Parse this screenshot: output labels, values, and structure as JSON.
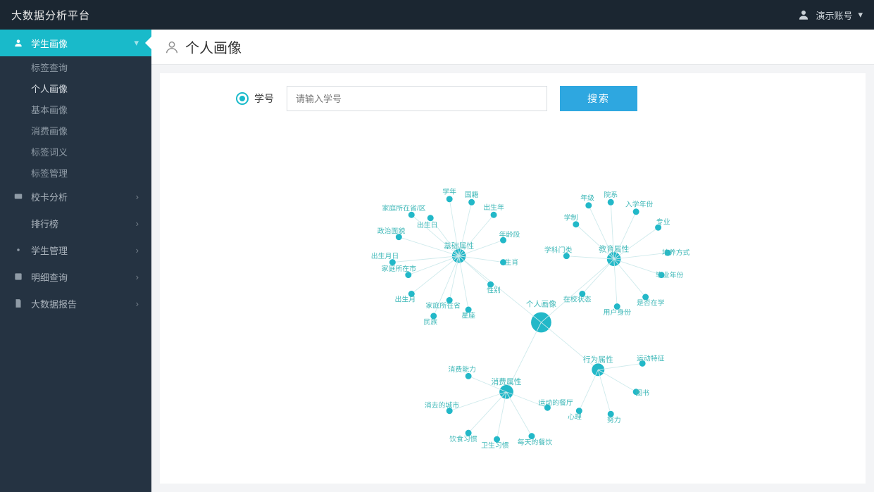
{
  "app": {
    "title": "大数据分析平台"
  },
  "user": {
    "name": "演示账号"
  },
  "sidebar": {
    "items": [
      {
        "label": "学生画像",
        "icon": "user-icon",
        "active": true
      },
      {
        "label": "校卡分析",
        "icon": "card-icon"
      },
      {
        "label": "排行榜",
        "icon": "rank-icon"
      },
      {
        "label": "学生管理",
        "icon": "manage-icon"
      },
      {
        "label": "明细查询",
        "icon": "detail-icon"
      },
      {
        "label": "大数据报告",
        "icon": "report-icon"
      }
    ],
    "sub": [
      {
        "label": "标签查询"
      },
      {
        "label": "个人画像",
        "current": true
      },
      {
        "label": "基本画像"
      },
      {
        "label": "消费画像"
      },
      {
        "label": "标签词义"
      },
      {
        "label": "标签管理"
      }
    ]
  },
  "page": {
    "title": "个人画像"
  },
  "form": {
    "radio_label": "学号",
    "input_placeholder": "请输入学号",
    "button": "搜索"
  },
  "graph": {
    "root": "个人画像",
    "clusters": [
      {
        "center": "基础属性",
        "nodes": [
          "学年",
          "国籍",
          "出生年",
          "年龄段",
          "生肖",
          "性别",
          "星座",
          "民族",
          "出生月",
          "出生月日",
          "家庭所在市",
          "家庭所在省",
          "政治面貌",
          "家庭所在省/区",
          "出生日"
        ]
      },
      {
        "center": "教育属性",
        "nodes": [
          "年级",
          "院系",
          "入学年份",
          "专业",
          "培养方式",
          "学制",
          "毕业年份",
          "是否在学",
          "用户身份",
          "在校状态",
          "学科门类"
        ]
      },
      {
        "center": "消费属性",
        "nodes": [
          "消费能力",
          "消去的城市",
          "饮食习惯",
          "卫生习惯",
          "每天的餐饮",
          "运动的餐厅"
        ]
      },
      {
        "center": "行为属性",
        "nodes": [
          "运动特征",
          "图书",
          "努力",
          "心理"
        ]
      }
    ]
  },
  "colors": {
    "accent": "#19baca",
    "button": "#2ea7e0",
    "graph": "#22b8c8"
  }
}
